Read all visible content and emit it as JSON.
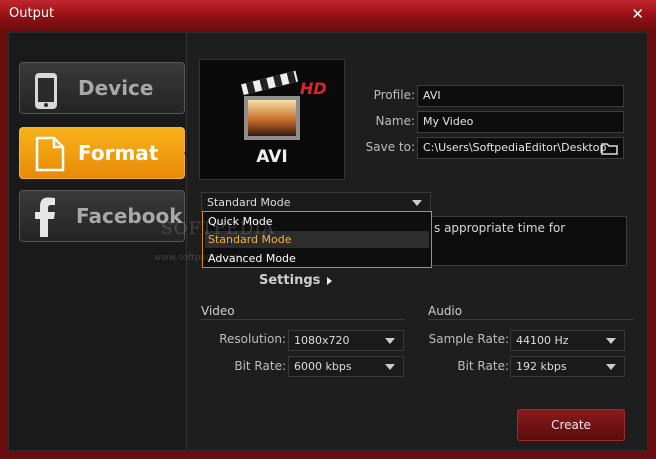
{
  "window": {
    "title": "Output",
    "close_glyph": "✕"
  },
  "nav": [
    {
      "label": "Device",
      "icon": "phone-icon",
      "active": false
    },
    {
      "label": "Format",
      "icon": "document-icon",
      "active": true
    },
    {
      "label": "Facebook",
      "icon": "facebook-icon",
      "active": false
    }
  ],
  "preview": {
    "badge": "HD",
    "format": "AVI",
    "icon": "clapperboard-icon"
  },
  "form": {
    "profile_label": "Profile:",
    "profile_value": "AVI",
    "name_label": "Name:",
    "name_value": "My Video",
    "saveto_label": "Save to:",
    "saveto_value": "C:\\Users\\SoftpediaEditor\\Desktop",
    "folder_icon": "folder-icon"
  },
  "mode": {
    "selected": "Standard Mode",
    "options": [
      "Quick Mode",
      "Standard Mode",
      "Advanced Mode"
    ],
    "highlighted_index": 1
  },
  "description": "s appropriate time for",
  "settings_label": "Settings",
  "video": {
    "group_label": "Video",
    "resolution_label": "Resolution:",
    "resolution_value": "1080x720",
    "bitrate_label": "Bit Rate:",
    "bitrate_value": "6000 kbps"
  },
  "audio": {
    "group_label": "Audio",
    "samplerate_label": "Sample Rate:",
    "samplerate_value": "44100 Hz",
    "bitrate_label": "Bit Rate:",
    "bitrate_value": "192 kbps"
  },
  "create_label": "Create",
  "watermark": {
    "main": "SOFTPEDIA",
    "sub": "www.softpedia.com"
  },
  "colors": {
    "accent": "#f09b10",
    "titlebar": "#9b1216",
    "create": "#7a1416"
  }
}
